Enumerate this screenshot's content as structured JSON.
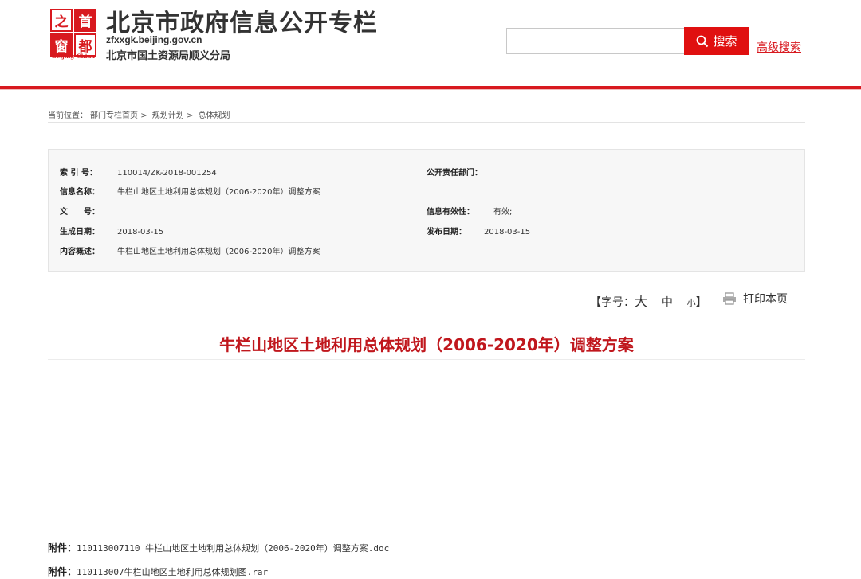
{
  "header": {
    "logo": {
      "chars": [
        "之",
        "首",
        "窗",
        "都"
      ],
      "tag": "Beijing-China"
    },
    "title": "北京市政府信息公开专栏",
    "domain": "zfxxgk.beijing.gov.cn",
    "department": "北京市国土资源局顺义分局",
    "search": {
      "placeholder": "",
      "button_label": "搜索",
      "advanced_label": "高级搜索"
    }
  },
  "breadcrumb": {
    "prefix": "当前位置：",
    "items": [
      "部门专栏首页",
      "规划计划",
      "总体规划"
    ],
    "separator": ">"
  },
  "meta": {
    "index_label": "索 引 号：",
    "index_value": "110014/ZK-2018-001254",
    "dept_label": "公开责任部门：",
    "dept_value": "",
    "name_label": "信息名称：",
    "name_value": "牛栏山地区土地利用总体规划（2006-2020年）调整方案",
    "docno_label": "文　　号：",
    "docno_value": "",
    "validity_label": "信息有效性：",
    "validity_value": "有效;",
    "created_label": "生成日期：",
    "created_value": "2018-03-15",
    "published_label": "发布日期：",
    "published_value": "2018-03-15",
    "summary_label": "内容概述：",
    "summary_value": "牛栏山地区土地利用总体规划（2006-2020年）调整方案"
  },
  "tools": {
    "font_label_open": "【字号：",
    "size_large": "大",
    "size_medium": "中",
    "size_small": "小",
    "font_label_close": "】",
    "print_label": "打印本页"
  },
  "article": {
    "title": "牛栏山地区土地利用总体规划（2006-2020年）调整方案"
  },
  "attachments": [
    {
      "label": "附件：",
      "file": "110113007110 牛栏山地区土地利用总体规划（2006-2020年）调整方案.doc"
    },
    {
      "label": "附件：",
      "file": "110113007牛栏山地区土地利用总体规划图.rar"
    }
  ],
  "colors": {
    "brand_red": "#d8191f",
    "title_red": "#c0171d",
    "search_red": "#e01010"
  }
}
